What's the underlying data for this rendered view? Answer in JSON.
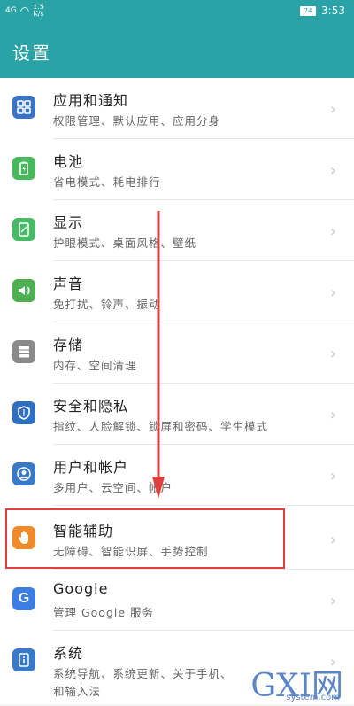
{
  "status": {
    "signal": "4G",
    "speed": "1.5\nK/s",
    "battery": "74",
    "time": "3:53"
  },
  "appbar": {
    "title": "设置"
  },
  "items": [
    {
      "title": "应用和通知",
      "subtitle": "权限管理、默认应用、应用分身",
      "icon": "apps-icon",
      "color": "#3b73c6"
    },
    {
      "title": "电池",
      "subtitle": "省电模式、耗电排行",
      "icon": "battery-icon",
      "color": "#47b85b"
    },
    {
      "title": "显示",
      "subtitle": "护眼模式、桌面风格、壁纸",
      "icon": "display-icon",
      "color": "#48b964"
    },
    {
      "title": "声音",
      "subtitle": "免打扰、铃声、振动",
      "icon": "sound-icon",
      "color": "#4caf50"
    },
    {
      "title": "存储",
      "subtitle": "内存、空间清理",
      "icon": "storage-icon",
      "color": "#8a8a8a"
    },
    {
      "title": "安全和隐私",
      "subtitle": "指纹、人脸解锁、锁屏和密码、学生模式",
      "icon": "shield-icon",
      "color": "#2f6fc2"
    },
    {
      "title": "用户和帐户",
      "subtitle": "多用户、云空间、帐户",
      "icon": "user-icon",
      "color": "#3a78c8"
    },
    {
      "title": "智能辅助",
      "subtitle": "无障碍、智能识屏、手势控制",
      "icon": "hand-icon",
      "color": "#ef8a2a"
    },
    {
      "title": "Google",
      "subtitle": "管理 Google 服务",
      "icon": "google-icon",
      "color": "#3b7de0"
    },
    {
      "title": "系统",
      "subtitle": "系统导航、系统更新、关于手机、",
      "subtitle2": "和输入法",
      "icon": "info-icon",
      "color": "#3a78c8"
    }
  ],
  "watermark": {
    "main": "GXI网",
    "sub": "system.com"
  }
}
